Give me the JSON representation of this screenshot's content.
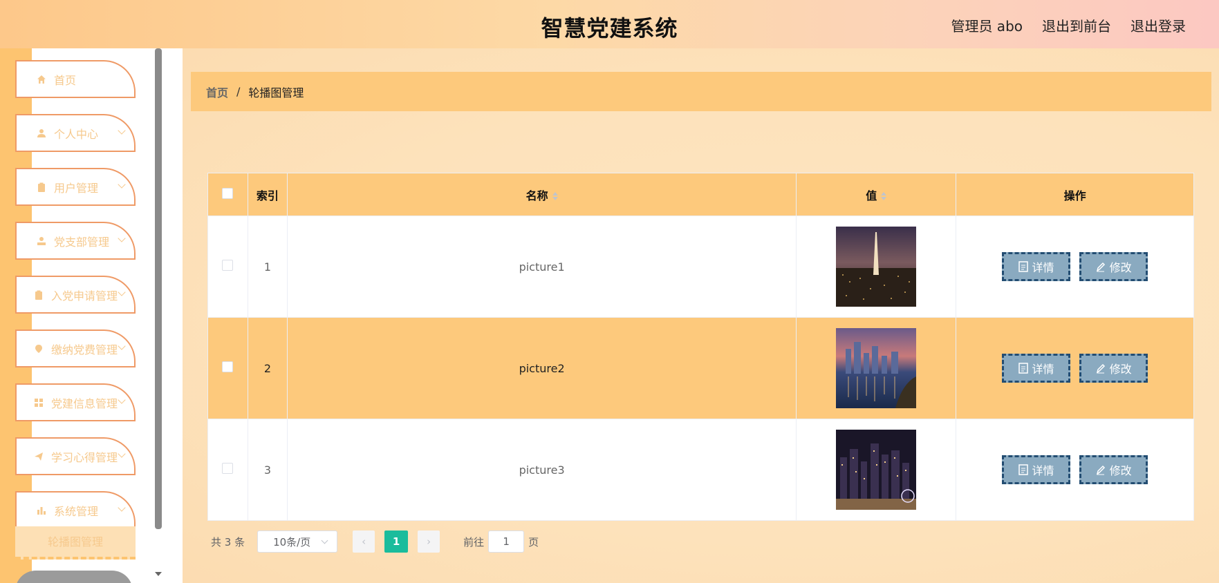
{
  "header": {
    "title": "智慧党建系统",
    "admin": "管理员 abo",
    "to_front": "退出到前台",
    "logout": "退出登录"
  },
  "sidebar": {
    "items": [
      {
        "label": "首页",
        "icon": "home-icon",
        "has_children": false
      },
      {
        "label": "个人中心",
        "icon": "user-icon",
        "has_children": true
      },
      {
        "label": "用户管理",
        "icon": "clipboard-icon",
        "has_children": true
      },
      {
        "label": "党支部管理",
        "icon": "person-icon",
        "has_children": true
      },
      {
        "label": "入党申请管理",
        "icon": "clipboard-icon",
        "has_children": true
      },
      {
        "label": "缴纳党费管理",
        "icon": "location-icon",
        "has_children": true
      },
      {
        "label": "党建信息管理",
        "icon": "grid-icon",
        "has_children": true
      },
      {
        "label": "学习心得管理",
        "icon": "send-icon",
        "has_children": true
      },
      {
        "label": "系统管理",
        "icon": "bar-chart-icon",
        "has_children": true
      }
    ],
    "sub_item": "轮播图管理"
  },
  "breadcrumb": {
    "home": "首页",
    "separator": "/",
    "current": "轮播图管理"
  },
  "table": {
    "headers": {
      "index": "索引",
      "name": "名称",
      "value": "值",
      "actions": "操作"
    },
    "rows": [
      {
        "index": "1",
        "name": "picture1",
        "image": "city-tower-night"
      },
      {
        "index": "2",
        "name": "picture2",
        "image": "city-waterfront-dusk"
      },
      {
        "index": "3",
        "name": "picture3",
        "image": "city-skyline-night"
      }
    ],
    "detail_label": "详情",
    "edit_label": "修改"
  },
  "pager": {
    "total": "共 3 条",
    "page_size": "10条/页",
    "current_page": "1",
    "goto_label": "前往",
    "goto_value": "1",
    "page_suffix": "页"
  },
  "colors": {
    "accent": "#fdc97c",
    "button": "#8aaac0",
    "button_border": "#234d72",
    "active_page": "#1abc9c",
    "menu_border": "#ef9a66"
  }
}
